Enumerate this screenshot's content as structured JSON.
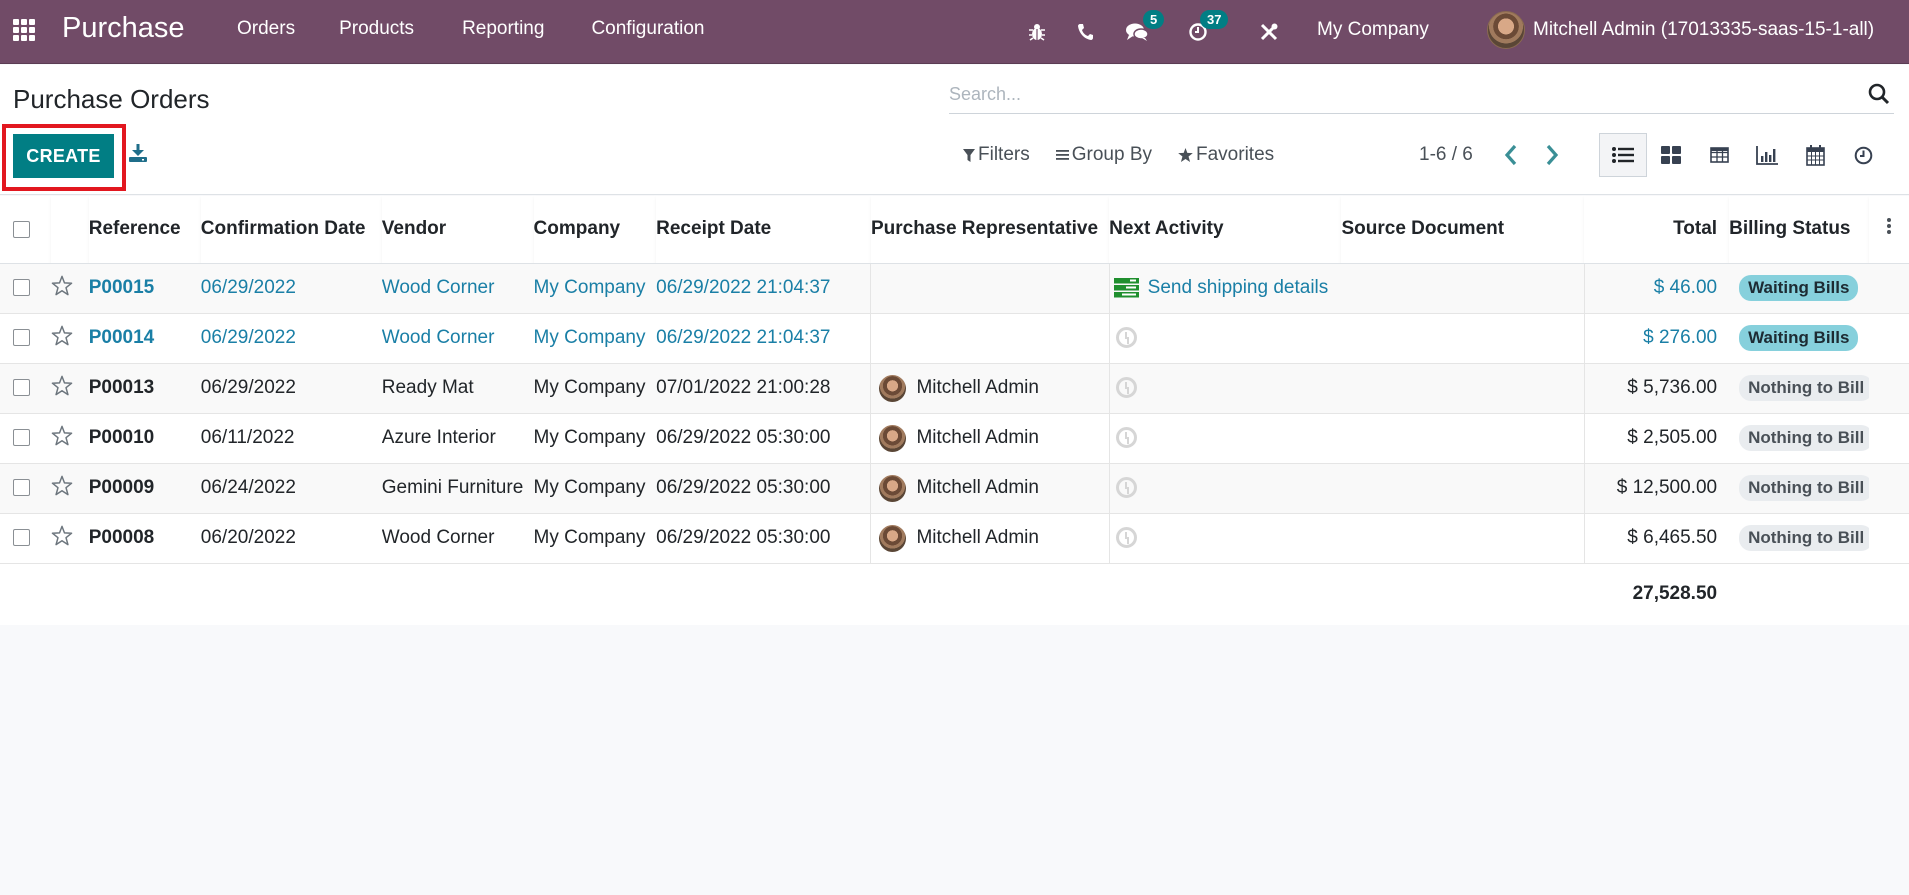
{
  "navbar": {
    "app_name": "Purchase",
    "menu": [
      "Orders",
      "Products",
      "Reporting",
      "Configuration"
    ],
    "icons": {
      "debug": "bug-icon",
      "phone": "phone-icon",
      "messages": "chat-icon",
      "activities": "clock-icon",
      "tools": "tools-icon"
    },
    "messages_count": "5",
    "activities_count": "37",
    "company": "My Company",
    "user": "Mitchell Admin (17013335-saas-15-1-all)"
  },
  "control": {
    "title": "Purchase Orders",
    "create_label": "CREATE",
    "search_placeholder": "Search...",
    "filters_label": "Filters",
    "groupby_label": "Group By",
    "favorites_label": "Favorites",
    "pager": "1-6 / 6",
    "views": [
      "list",
      "kanban",
      "pivot",
      "graph",
      "calendar",
      "activity"
    ],
    "active_view": "list"
  },
  "table": {
    "columns": [
      "Reference",
      "Confirmation Date",
      "Vendor",
      "Company",
      "Receipt Date",
      "Purchase Representative",
      "Next Activity",
      "Source Document",
      "Total",
      "Billing Status"
    ],
    "rows": [
      {
        "reference": "P00015",
        "confirmation_date": "06/29/2022",
        "vendor": "Wood Corner",
        "company": "My Company",
        "receipt_date": "06/29/2022 21:04:37",
        "representative": "",
        "next_activity": "Send shipping details",
        "source_document": "",
        "total": "$ 46.00",
        "billing_status": "Waiting Bills",
        "highlight": true
      },
      {
        "reference": "P00014",
        "confirmation_date": "06/29/2022",
        "vendor": "Wood Corner",
        "company": "My Company",
        "receipt_date": "06/29/2022 21:04:37",
        "representative": "",
        "next_activity": "",
        "source_document": "",
        "total": "$ 276.00",
        "billing_status": "Waiting Bills",
        "highlight": true
      },
      {
        "reference": "P00013",
        "confirmation_date": "06/29/2022",
        "vendor": "Ready Mat",
        "company": "My Company",
        "receipt_date": "07/01/2022 21:00:28",
        "representative": "Mitchell Admin",
        "next_activity": "",
        "source_document": "",
        "total": "$ 5,736.00",
        "billing_status": "Nothing to Bill",
        "highlight": false
      },
      {
        "reference": "P00010",
        "confirmation_date": "06/11/2022",
        "vendor": "Azure Interior",
        "company": "My Company",
        "receipt_date": "06/29/2022 05:30:00",
        "representative": "Mitchell Admin",
        "next_activity": "",
        "source_document": "",
        "total": "$ 2,505.00",
        "billing_status": "Nothing to Bill",
        "highlight": false
      },
      {
        "reference": "P00009",
        "confirmation_date": "06/24/2022",
        "vendor": "Gemini Furniture",
        "company": "My Company",
        "receipt_date": "06/29/2022 05:30:00",
        "representative": "Mitchell Admin",
        "next_activity": "",
        "source_document": "",
        "total": "$ 12,500.00",
        "billing_status": "Nothing to Bill",
        "highlight": false
      },
      {
        "reference": "P00008",
        "confirmation_date": "06/20/2022",
        "vendor": "Wood Corner",
        "company": "My Company",
        "receipt_date": "06/29/2022 05:30:00",
        "representative": "Mitchell Admin",
        "next_activity": "",
        "source_document": "",
        "total": "$ 6,465.50",
        "billing_status": "Nothing to Bill",
        "highlight": false
      }
    ],
    "sum_total": "27,528.50"
  },
  "colors": {
    "brand": "#714b67",
    "primary": "#017e84",
    "link": "#1a7fa6",
    "waiting_badge": "#86d0dc",
    "nothing_badge": "#e9ecef",
    "highlight_box": "#e2171f"
  }
}
